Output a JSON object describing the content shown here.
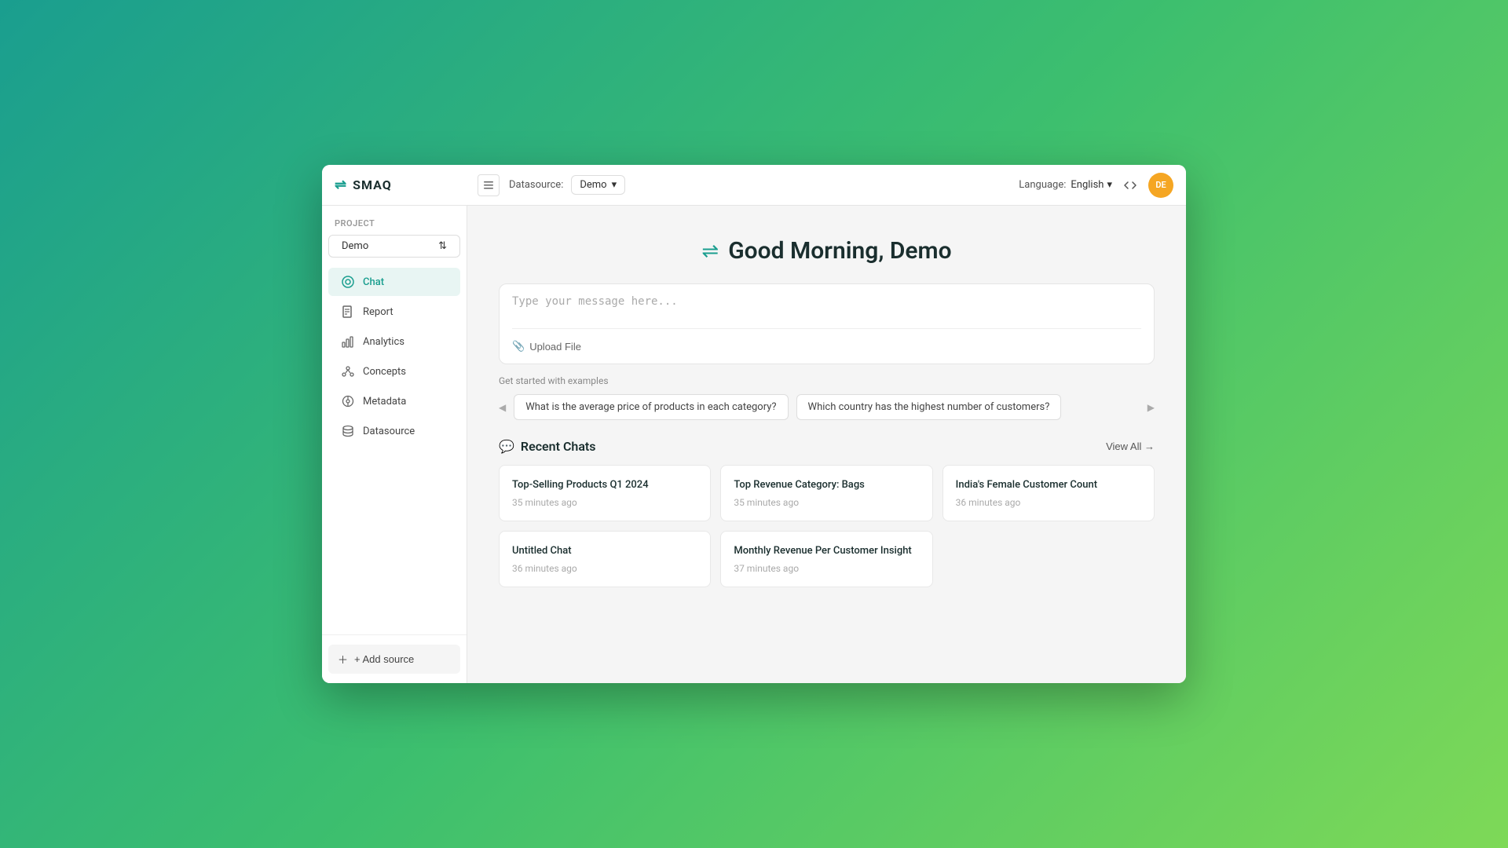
{
  "header": {
    "logo_text": "SMAQ",
    "sidebar_toggle_label": "≡",
    "datasource_label": "Datasource:",
    "datasource_value": "Demo",
    "language_label": "Language:",
    "language_value": "English",
    "avatar_initials": "DE"
  },
  "sidebar": {
    "section_label": "Project",
    "project_value": "Demo",
    "nav_items": [
      {
        "id": "chat",
        "label": "Chat",
        "active": true
      },
      {
        "id": "report",
        "label": "Report",
        "active": false
      },
      {
        "id": "analytics",
        "label": "Analytics",
        "active": false
      },
      {
        "id": "concepts",
        "label": "Concepts",
        "active": false
      },
      {
        "id": "metadata",
        "label": "Metadata",
        "active": false
      },
      {
        "id": "datasource",
        "label": "Datasource",
        "active": false
      }
    ],
    "add_source_label": "+ Add source"
  },
  "main": {
    "greeting": "Good Morning, Demo",
    "message_placeholder": "Type your message here...",
    "upload_label": "Upload File",
    "examples_label": "Get started with examples",
    "examples": [
      "What is the average price of products in each category?",
      "Which country has the highest number of customers?"
    ],
    "recent_chats_title": "Recent Chats",
    "view_all_label": "View All →",
    "chat_cards": [
      {
        "title": "Top-Selling Products Q1 2024",
        "time": "35 minutes ago"
      },
      {
        "title": "Top Revenue Category: Bags",
        "time": "35 minutes ago"
      },
      {
        "title": "India's Female Customer Count",
        "time": "36 minutes ago"
      },
      {
        "title": "Untitled Chat",
        "time": "36 minutes ago"
      },
      {
        "title": "Monthly Revenue Per Customer Insight",
        "time": "37 minutes ago"
      }
    ]
  },
  "colors": {
    "accent": "#1a9e8f",
    "avatar_bg": "#f5a623"
  }
}
